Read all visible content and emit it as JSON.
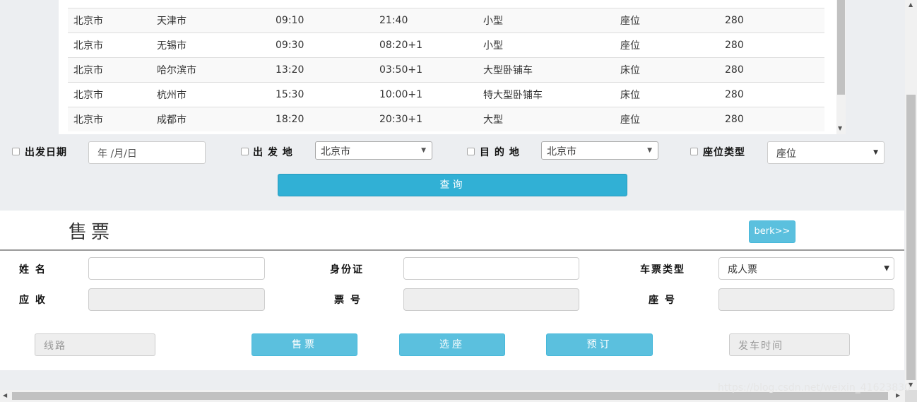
{
  "schedule": {
    "rows": [
      [
        "北京市",
        "天津市",
        "09:10",
        "21:40",
        "小型",
        "座位",
        "280"
      ],
      [
        "北京市",
        "无锡市",
        "09:30",
        "08:20+1",
        "小型",
        "座位",
        "280"
      ],
      [
        "北京市",
        "哈尔滨市",
        "13:20",
        "03:50+1",
        "大型卧铺车",
        "床位",
        "280"
      ],
      [
        "北京市",
        "杭州市",
        "15:30",
        "10:00+1",
        "特大型卧铺车",
        "床位",
        "280"
      ],
      [
        "北京市",
        "成都市",
        "18:20",
        "20:30+1",
        "大型",
        "座位",
        "280"
      ]
    ]
  },
  "query": {
    "date_label": "出发日期",
    "date_placeholder": "年 /月/日",
    "origin_label": "出 发 地",
    "origin_value": "北京市",
    "dest_label": "目 的 地",
    "dest_value": "北京市",
    "seat_type_label": "座位类型",
    "seat_type_value": "座位",
    "search_button": "查询"
  },
  "sale": {
    "title": "售票",
    "berk_button": "berk>>",
    "name_label": "姓 名",
    "id_label": "身份证",
    "ticket_type_label": "车票类型",
    "ticket_type_value": "成人票",
    "receivable_label": "应 收",
    "ticket_no_label": "票 号",
    "seat_no_label": "座 号",
    "route_placeholder": "线路",
    "sell_button": "售票",
    "choose_seat_button": "选座",
    "reserve_button": "预订",
    "departure_placeholder": "发车时间"
  },
  "watermark": "https://blog.csdn.net/weixin_41623830",
  "icons": {
    "dropdown": "chevron-down-icon",
    "checkbox": "checkbox-icon"
  }
}
